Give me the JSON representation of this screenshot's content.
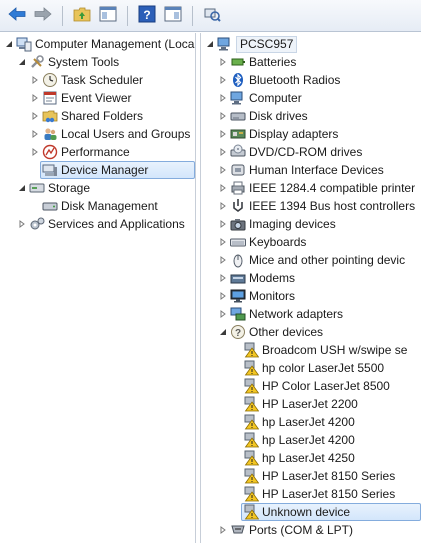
{
  "colors": {
    "toolbar_bg": "#e6ecf5",
    "selection_bg": "#d3e6fb",
    "selection_border": "#84acdd",
    "warning_yellow": "#f3c623"
  },
  "toolbar": {
    "buttons": [
      {
        "name": "back-button",
        "icon": "arrow-left-icon"
      },
      {
        "name": "forward-button",
        "icon": "arrow-right-icon"
      },
      {
        "name": "up-folder-button",
        "icon": "folder-up-icon"
      },
      {
        "name": "show-hide-tree-button",
        "icon": "console-tree-icon"
      },
      {
        "name": "help-button",
        "icon": "help-icon"
      },
      {
        "name": "action-pane-button",
        "icon": "action-pane-icon"
      },
      {
        "name": "scan-hardware-button",
        "icon": "scan-hardware-icon"
      }
    ]
  },
  "left_tree": {
    "items": [
      {
        "label": "Computer Management (Local",
        "icon": "computer-management-icon",
        "level": 0,
        "expander": "open"
      },
      {
        "label": "System Tools",
        "icon": "tools-icon",
        "level": 1,
        "expander": "open"
      },
      {
        "label": "Task Scheduler",
        "icon": "clock-icon",
        "level": 2,
        "expander": "closed"
      },
      {
        "label": "Event Viewer",
        "icon": "event-viewer-icon",
        "level": 2,
        "expander": "closed"
      },
      {
        "label": "Shared Folders",
        "icon": "shared-folder-icon",
        "level": 2,
        "expander": "closed"
      },
      {
        "label": "Local Users and Groups",
        "icon": "users-icon",
        "level": 2,
        "expander": "closed"
      },
      {
        "label": "Performance",
        "icon": "performance-icon",
        "level": 2,
        "expander": "closed"
      },
      {
        "label": "Device Manager",
        "icon": "device-manager-icon",
        "level": 2,
        "expander": "none",
        "selected": true
      },
      {
        "label": "Storage",
        "icon": "storage-icon",
        "level": 1,
        "expander": "open"
      },
      {
        "label": "Disk Management",
        "icon": "disk-management-icon",
        "level": 2,
        "expander": "none"
      },
      {
        "label": "Services and Applications",
        "icon": "services-icon",
        "level": 1,
        "expander": "closed"
      }
    ]
  },
  "right_tree": {
    "root": {
      "label": "PCSC957",
      "icon": "computer-icon"
    },
    "items": [
      {
        "label": "Batteries",
        "icon": "battery-icon",
        "level": 1,
        "expander": "closed"
      },
      {
        "label": "Bluetooth Radios",
        "icon": "bluetooth-icon",
        "level": 1,
        "expander": "closed"
      },
      {
        "label": "Computer",
        "icon": "computer-icon",
        "level": 1,
        "expander": "closed"
      },
      {
        "label": "Disk drives",
        "icon": "disk-drive-icon",
        "level": 1,
        "expander": "closed"
      },
      {
        "label": "Display adapters",
        "icon": "display-adapter-icon",
        "level": 1,
        "expander": "closed"
      },
      {
        "label": "DVD/CD-ROM drives",
        "icon": "dvd-drive-icon",
        "level": 1,
        "expander": "closed"
      },
      {
        "label": "Human Interface Devices",
        "icon": "hid-icon",
        "level": 1,
        "expander": "closed"
      },
      {
        "label": "IEEE 1284.4 compatible printer",
        "icon": "printer-icon",
        "level": 1,
        "expander": "closed"
      },
      {
        "label": "IEEE 1394 Bus host controllers",
        "icon": "firewire-icon",
        "level": 1,
        "expander": "closed"
      },
      {
        "label": "Imaging devices",
        "icon": "camera-icon",
        "level": 1,
        "expander": "closed"
      },
      {
        "label": "Keyboards",
        "icon": "keyboard-icon",
        "level": 1,
        "expander": "closed"
      },
      {
        "label": "Mice and other pointing devic",
        "icon": "mouse-icon",
        "level": 1,
        "expander": "closed"
      },
      {
        "label": "Modems",
        "icon": "modem-icon",
        "level": 1,
        "expander": "closed"
      },
      {
        "label": "Monitors",
        "icon": "monitor-icon",
        "level": 1,
        "expander": "closed"
      },
      {
        "label": "Network adapters",
        "icon": "network-adapter-icon",
        "level": 1,
        "expander": "closed"
      },
      {
        "label": "Other devices",
        "icon": "other-devices-icon",
        "level": 1,
        "expander": "open"
      },
      {
        "label": "Broadcom USH w/swipe se",
        "icon": "warning-device-icon",
        "level": 2,
        "expander": "none"
      },
      {
        "label": "hp color LaserJet 5500",
        "icon": "warning-device-icon",
        "level": 2,
        "expander": "none"
      },
      {
        "label": "HP Color LaserJet 8500",
        "icon": "warning-device-icon",
        "level": 2,
        "expander": "none"
      },
      {
        "label": "HP LaserJet 2200",
        "icon": "warning-device-icon",
        "level": 2,
        "expander": "none"
      },
      {
        "label": "hp LaserJet 4200",
        "icon": "warning-device-icon",
        "level": 2,
        "expander": "none"
      },
      {
        "label": "hp LaserJet 4200",
        "icon": "warning-device-icon",
        "level": 2,
        "expander": "none"
      },
      {
        "label": "hp LaserJet 4250",
        "icon": "warning-device-icon",
        "level": 2,
        "expander": "none"
      },
      {
        "label": "HP LaserJet 8150 Series",
        "icon": "warning-device-icon",
        "level": 2,
        "expander": "none"
      },
      {
        "label": "HP LaserJet 8150 Series",
        "icon": "warning-device-icon",
        "level": 2,
        "expander": "none"
      },
      {
        "label": "Unknown device",
        "icon": "warning-device-icon",
        "level": 2,
        "expander": "none",
        "selected": true
      },
      {
        "label": "Ports (COM & LPT)",
        "icon": "port-icon",
        "level": 1,
        "expander": "closed"
      }
    ]
  }
}
